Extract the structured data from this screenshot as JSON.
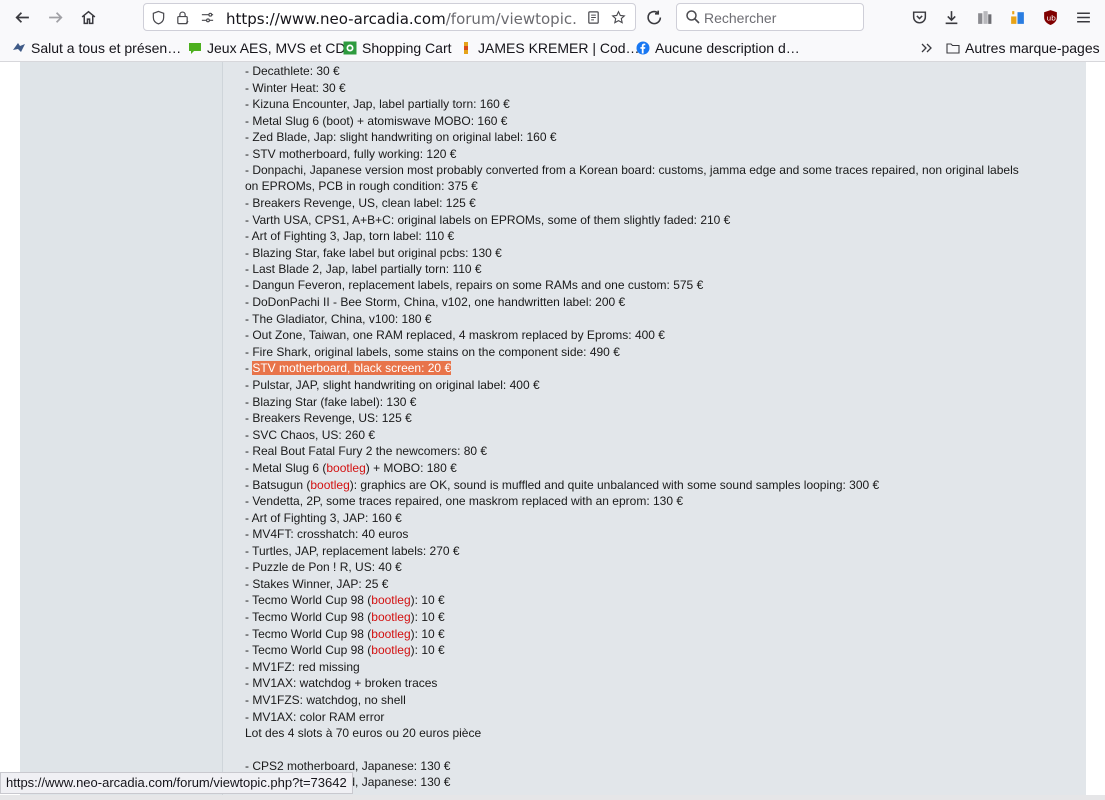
{
  "browser": {
    "url_host": "https://www.neo-arcadia.com",
    "url_path": "/forum/viewtopic.php?t=7",
    "search_placeholder": "Rechercher",
    "status_url": "https://www.neo-arcadia.com/forum/viewtopic.php?t=73642"
  },
  "bookmarks": [
    {
      "label": "Salut a tous et présen…",
      "icon": "forum-icon"
    },
    {
      "label": "Jeux AES, MVS et CD",
      "icon": "chat-bubble-icon"
    },
    {
      "label": "Shopping Cart",
      "icon": "shopping-cart-icon"
    },
    {
      "label": "JAMES KREMER | Cod…",
      "icon": "pin-icon"
    },
    {
      "label": "Aucune description d…",
      "icon": "facebook-icon"
    },
    {
      "label": "Autres marque-pages",
      "icon": "folder-icon"
    }
  ],
  "post": {
    "lines": [
      {
        "text": "- Decathlete: 30 €"
      },
      {
        "text": "- Winter Heat: 30 €"
      },
      {
        "text": "- Kizuna Encounter, Jap, label partially torn: 160 €"
      },
      {
        "text": "- Metal Slug 6 (boot) + atomiswave MOBO: 160 €"
      },
      {
        "text": "- Zed Blade, Jap: slight handwriting on original label: 160 €"
      },
      {
        "text": "- STV motherboard, fully working: 120 €"
      },
      {
        "text": "- Donpachi, Japanese version most probably converted from a Korean board: customs, jamma edge and some traces repaired, non original labels on EPROMs, PCB in rough condition: 375 €"
      },
      {
        "text": "- Breakers Revenge, US, clean label: 125 €"
      },
      {
        "text": "- Varth USA, CPS1, A+B+C: original labels on EPROMs, some of them slightly faded: 210 €"
      },
      {
        "text": "- Art of Fighting 3, Jap, torn label: 110 €"
      },
      {
        "text": "- Blazing Star, fake label but original pcbs: 130 €"
      },
      {
        "text": "- Last Blade 2, Jap, label partially torn: 110 €"
      },
      {
        "text": "- Dangun Feveron, replacement labels, repairs on some RAMs and one custom: 575 €"
      },
      {
        "text": "- DoDonPachi II - Bee Storm, China, v102, one handwritten label: 200 €"
      },
      {
        "text": "- The Gladiator, China, v100: 180 €"
      },
      {
        "text": "- Out Zone, Taiwan, one RAM replaced, 4 maskrom replaced by Eproms: 400 €"
      },
      {
        "text": "- Fire Shark, original labels, some stains on the component side: 490 €"
      },
      {
        "prefix": "- ",
        "highlight": "STV motherboard, black screen: 20 €"
      },
      {
        "text": "- Pulstar, JAP, slight handwriting on original label: 400 €"
      },
      {
        "text": "- Blazing Star (fake label): 130 €"
      },
      {
        "text": "- Breakers Revenge, US: 125 €"
      },
      {
        "text": "- SVC Chaos, US: 260 €"
      },
      {
        "text": "- Real Bout Fatal Fury 2 the newcomers: 80 €"
      },
      {
        "prefix": "- Metal Slug 6 (",
        "red": "bootleg",
        "suffix": ") + MOBO: 180 €"
      },
      {
        "prefix": "- Batsugun (",
        "red": "bootleg",
        "suffix": "): graphics are OK, sound is muffled and quite unbalanced with some sound samples looping: 300 €"
      },
      {
        "text": "- Vendetta, 2P, some traces repaired, one maskrom replaced with an eprom: 130 €"
      },
      {
        "text": "- Art of Fighting 3, JAP: 160 €"
      },
      {
        "text": "- MV4FT: crosshatch: 40 euros"
      },
      {
        "text": "- Turtles, JAP, replacement labels: 270 €"
      },
      {
        "text": "- Puzzle de Pon ! R, US: 40 €"
      },
      {
        "text": "- Stakes Winner, JAP: 25 €"
      },
      {
        "prefix": "- Tecmo World Cup 98 (",
        "red": "bootleg",
        "suffix": "): 10 €"
      },
      {
        "prefix": "- Tecmo World Cup 98 (",
        "red": "bootleg",
        "suffix": "): 10 €"
      },
      {
        "prefix": "- Tecmo World Cup 98 (",
        "red": "bootleg",
        "suffix": "): 10 €"
      },
      {
        "prefix": "- Tecmo World Cup 98 (",
        "red": "bootleg",
        "suffix": "): 10 €"
      },
      {
        "text": "- MV1FZ: red missing"
      },
      {
        "text": "- MV1AX: watchdog + broken traces"
      },
      {
        "text": "- MV1FZS: watchdog, no shell"
      },
      {
        "text": "- MV1AX: color RAM error"
      },
      {
        "text": "Lot des 4 slots à 70 euros ou 20 euros pièce"
      },
      {
        "text": ""
      },
      {
        "text": "- CPS2 motherboard, Japanese: 130 €"
      },
      {
        "text": "- CPS2 motherboard, Japanese: 130 €"
      }
    ]
  },
  "colors": {
    "post_bg": "#e2e6ea",
    "highlight": "#e8744a",
    "bootleg_red": "#d31111"
  }
}
